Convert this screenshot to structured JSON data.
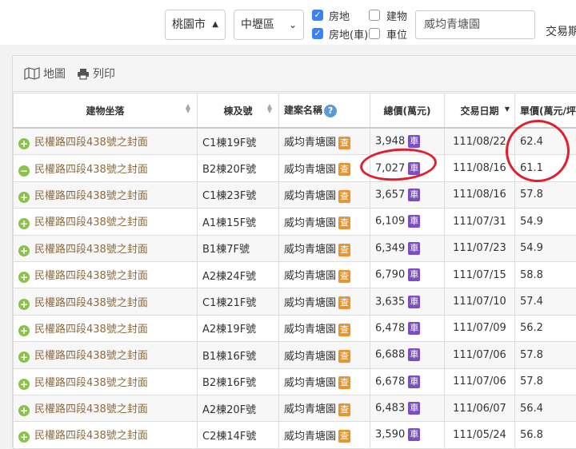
{
  "filters": {
    "city": "桃園市",
    "district": "中壢區",
    "checkboxes": [
      {
        "label": "房地",
        "checked": true
      },
      {
        "label": "建物",
        "checked": false
      },
      {
        "label": "房地(車)",
        "checked": true
      },
      {
        "label": "車位",
        "checked": false
      }
    ],
    "keyword": "威均青塘園",
    "trade_label": "交易期"
  },
  "toolbar": {
    "map_label": "地圖",
    "print_label": "列印"
  },
  "columns": [
    "建物坐落",
    "棟及號",
    "建案名稱",
    "總價(萬元)",
    "交易日期",
    "單價(萬元/坪)"
  ],
  "tags": {
    "cha": "查",
    "che": "車"
  },
  "help_glyph": "?",
  "rows": [
    {
      "address": "民權路四段438號之封面",
      "unit": "C1棟19F號",
      "project": "威均青塘園",
      "total": "3,948",
      "date": "111/08/22",
      "unit_price": "62.4",
      "expanded": false
    },
    {
      "address": "民權路四段438號之封面",
      "unit": "B2棟20F號",
      "project": "威均青塘園",
      "total": "7,027",
      "date": "111/08/16",
      "unit_price": "61.1",
      "expanded": true
    },
    {
      "address": "民權路四段438號之封面",
      "unit": "C1棟23F號",
      "project": "威均青塘園",
      "total": "3,657",
      "date": "111/08/16",
      "unit_price": "57.8",
      "expanded": false
    },
    {
      "address": "民權路四段438號之封面",
      "unit": "A1棟15F號",
      "project": "威均青塘園",
      "total": "6,109",
      "date": "111/07/31",
      "unit_price": "54.9",
      "expanded": false
    },
    {
      "address": "民權路四段438號之封面",
      "unit": "B1棟7F號",
      "project": "威均青塘園",
      "total": "6,349",
      "date": "111/07/23",
      "unit_price": "54.9",
      "expanded": false
    },
    {
      "address": "民權路四段438號之封面",
      "unit": "A2棟24F號",
      "project": "威均青塘園",
      "total": "6,790",
      "date": "111/07/15",
      "unit_price": "58.8",
      "expanded": false
    },
    {
      "address": "民權路四段438號之封面",
      "unit": "C1棟21F號",
      "project": "威均青塘園",
      "total": "3,635",
      "date": "111/07/10",
      "unit_price": "57.4",
      "expanded": false
    },
    {
      "address": "民權路四段438號之封面",
      "unit": "A2棟19F號",
      "project": "威均青塘園",
      "total": "6,478",
      "date": "111/07/09",
      "unit_price": "56.2",
      "expanded": false
    },
    {
      "address": "民權路四段438號之封面",
      "unit": "B1棟16F號",
      "project": "威均青塘園",
      "total": "6,688",
      "date": "111/07/06",
      "unit_price": "57.8",
      "expanded": false
    },
    {
      "address": "民權路四段438號之封面",
      "unit": "B2棟16F號",
      "project": "威均青塘園",
      "total": "6,678",
      "date": "111/07/06",
      "unit_price": "57.8",
      "expanded": false
    },
    {
      "address": "民權路四段438號之封面",
      "unit": "A2棟20F號",
      "project": "威均青塘園",
      "total": "6,483",
      "date": "111/06/07",
      "unit_price": "56.4",
      "expanded": false
    },
    {
      "address": "民權路四段438號之封面",
      "unit": "C2棟14F號",
      "project": "威均青塘園",
      "total": "3,590",
      "date": "111/05/24",
      "unit_price": "56.8",
      "expanded": false
    }
  ]
}
